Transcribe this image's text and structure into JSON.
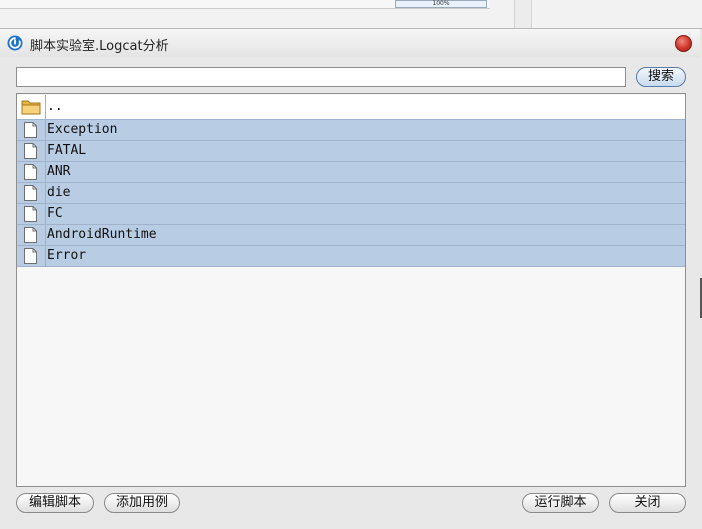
{
  "background": {
    "zoom_label": "100%"
  },
  "window": {
    "title": "脚本实验室.Logcat分析",
    "title_icon": "app-refresh-icon",
    "close_icon": "close-icon"
  },
  "search": {
    "value": "",
    "placeholder": "",
    "button_label": "搜索"
  },
  "list": {
    "parent_label": "..",
    "items": [
      {
        "label": "Exception",
        "icon": "file-icon"
      },
      {
        "label": "FATAL",
        "icon": "file-icon"
      },
      {
        "label": "ANR",
        "icon": "file-icon"
      },
      {
        "label": "die",
        "icon": "file-icon"
      },
      {
        "label": "FC",
        "icon": "file-icon"
      },
      {
        "label": "AndroidRuntime",
        "icon": "file-icon"
      },
      {
        "label": "Error",
        "icon": "file-icon"
      }
    ]
  },
  "footer": {
    "edit_label": "编辑脚本",
    "add_label": "添加用例",
    "run_label": "运行脚本",
    "close_label": "关闭"
  },
  "colors": {
    "selection": "#b8cde4",
    "close_button": "#d0352a",
    "accent": "#1e73c8"
  }
}
